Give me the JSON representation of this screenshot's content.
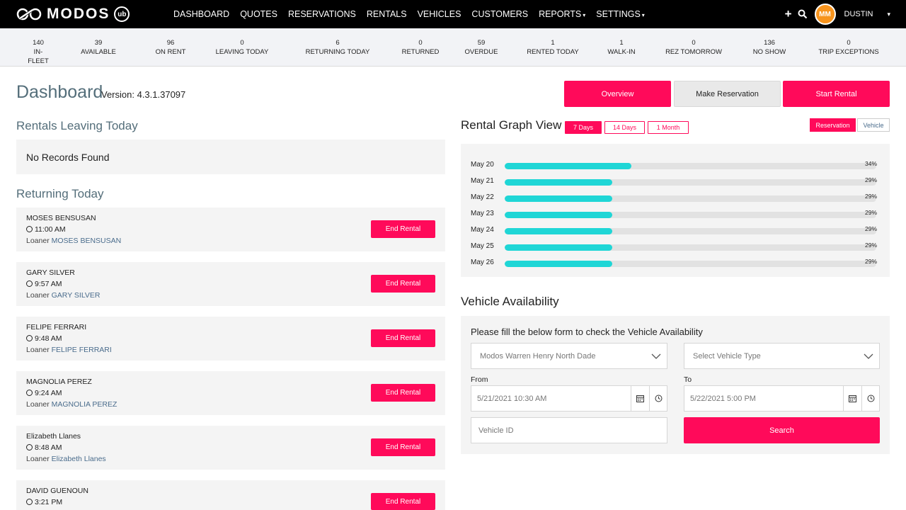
{
  "nav": {
    "brand": "MODOS",
    "badge": "ub",
    "links": [
      {
        "label": "DASHBOARD",
        "caret": ""
      },
      {
        "label": "QUOTES",
        "caret": ""
      },
      {
        "label": "RESERVATIONS",
        "caret": ""
      },
      {
        "label": "RENTALS",
        "caret": ""
      },
      {
        "label": "VEHICLES",
        "caret": ""
      },
      {
        "label": "CUSTOMERS",
        "caret": ""
      },
      {
        "label": "REPORTS",
        "caret": "▾"
      },
      {
        "label": "SETTINGS",
        "caret": "▾"
      }
    ],
    "add_icon": "+",
    "search_icon": "⌕",
    "avatar_text": "ММ",
    "username": "DUSTIN",
    "user_caret": "▾"
  },
  "stats": [
    {
      "value": "140",
      "label": "IN-FLEET"
    },
    {
      "value": "39",
      "label": "AVAILABLE"
    },
    {
      "value": "96",
      "label": "ON RENT"
    },
    {
      "value": "0",
      "label": "LEAVING TODAY"
    },
    {
      "value": "6",
      "label": "RETURNING TODAY"
    },
    {
      "value": "0",
      "label": "RETURNED"
    },
    {
      "value": "59",
      "label": "OVERDUE"
    },
    {
      "value": "1",
      "label": "RENTED TODAY"
    },
    {
      "value": "1",
      "label": "WALK-IN"
    },
    {
      "value": "0",
      "label": "REZ TOMORROW"
    },
    {
      "value": "136",
      "label": "NO SHOW"
    },
    {
      "value": "0",
      "label": "TRIP EXCEPTIONS"
    }
  ],
  "header": {
    "title": "Dashboard",
    "version": "Version: 4.3.1.37097",
    "overview_label": "Overview",
    "make_reservation_label": "Make Reservation",
    "start_rental_label": "Start Rental"
  },
  "leaving": {
    "title": "Rentals Leaving Today",
    "empty_text": "No Records Found"
  },
  "returning": {
    "title": "Returning Today",
    "loaner_prefix": "Loaner",
    "end_label": "End Rental",
    "items": [
      {
        "name": "MOSES BENSUSAN",
        "time": "11:00 AM",
        "loaner": "MOSES BENSUSAN"
      },
      {
        "name": "GARY SILVER",
        "time": "9:57 AM",
        "loaner": "GARY SILVER"
      },
      {
        "name": "FELIPE FERRARI",
        "time": "9:48 AM",
        "loaner": "FELIPE FERRARI"
      },
      {
        "name": "MAGNOLIA PEREZ",
        "time": "9:24 AM",
        "loaner": "MAGNOLIA PEREZ"
      },
      {
        "name": "Elizabeth Llanes",
        "time": "8:48 AM",
        "loaner": "Elizabeth Llanes"
      },
      {
        "name": "DAVID GUENOUN",
        "time": "3:21 PM",
        "loaner": ""
      }
    ]
  },
  "graph": {
    "title": "Rental Graph View",
    "ranges": [
      "7 Days",
      "14 Days",
      "1 Month"
    ],
    "toggle_reservation": "Reservation",
    "toggle_vehicle": "Vehicle",
    "fill_color": "#1fd6d6",
    "rows": [
      {
        "date": "May 20",
        "pct": 34,
        "pct_label": "34%"
      },
      {
        "date": "May 21",
        "pct": 29,
        "pct_label": "29%"
      },
      {
        "date": "May 22",
        "pct": 29,
        "pct_label": "29%"
      },
      {
        "date": "May 23",
        "pct": 29,
        "pct_label": "29%"
      },
      {
        "date": "May 24",
        "pct": 29,
        "pct_label": "29%"
      },
      {
        "date": "May 25",
        "pct": 29,
        "pct_label": "29%"
      },
      {
        "date": "May 26",
        "pct": 29,
        "pct_label": "29%"
      }
    ]
  },
  "availability": {
    "title": "Vehicle Availability",
    "description": "Please fill the below form to check the Vehicle Availability",
    "location_value": "Modos Warren Henry North Dade",
    "vehicle_type_placeholder": "Select Vehicle Type",
    "from_label": "From",
    "from_value": "5/21/2021 10:30 AM",
    "to_label": "To",
    "to_value": "5/22/2021 5:00 PM",
    "vehicle_id_placeholder": "Vehicle ID",
    "search_label": "Search"
  },
  "colors": {
    "accent": "#ff0a5a",
    "nav_bg": "#000000",
    "title": "#546e7a",
    "link": "#4a6c8c"
  }
}
